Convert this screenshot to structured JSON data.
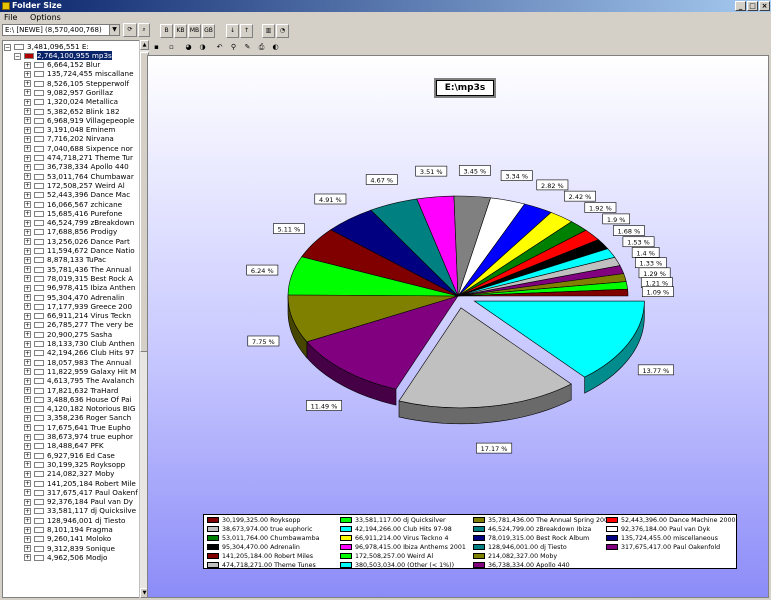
{
  "window": {
    "title": "Folder Size"
  },
  "menu": [
    "File",
    "Options"
  ],
  "drive_select": {
    "value": "E:\\ [NEWE] (8,570,400,768)"
  },
  "toolbar": {
    "b": "B",
    "kb": "KB",
    "mb": "MB",
    "gb": "GB"
  },
  "tree": {
    "root": {
      "size": "3,481,096,551",
      "name": "E:"
    },
    "selected": {
      "size": "2,764,100,955",
      "name": "mp3s"
    },
    "items": [
      {
        "size": "6,664,152",
        "name": "Blur"
      },
      {
        "size": "135,724,455",
        "name": "miscallane"
      },
      {
        "size": "8,526,105",
        "name": "Stepperwolf"
      },
      {
        "size": "9,082,957",
        "name": "Gorillaz"
      },
      {
        "size": "1,320,024",
        "name": "Metallica"
      },
      {
        "size": "5,382,652",
        "name": "Blink 182"
      },
      {
        "size": "6,968,919",
        "name": "Villagepeople"
      },
      {
        "size": "3,191,048",
        "name": "Eminem"
      },
      {
        "size": "7,716,202",
        "name": "Nirvana"
      },
      {
        "size": "7,040,688",
        "name": "Sixpence nor"
      },
      {
        "size": "474,718,271",
        "name": "Theme Tur"
      },
      {
        "size": "36,738,334",
        "name": "Apollo 440"
      },
      {
        "size": "53,011,764",
        "name": "Chumbawar"
      },
      {
        "size": "172,508,257",
        "name": "Weird Al"
      },
      {
        "size": "52,443,396",
        "name": "Dance Mac"
      },
      {
        "size": "16,066,567",
        "name": "zchicane"
      },
      {
        "size": "15,685,416",
        "name": "Purefone"
      },
      {
        "size": "46,524,799",
        "name": "zBreakdown"
      },
      {
        "size": "17,688,856",
        "name": "Prodigy"
      },
      {
        "size": "13,256,026",
        "name": "Dance Part"
      },
      {
        "size": "11,594,672",
        "name": "Dance Natio"
      },
      {
        "size": "8,878,133",
        "name": "TuPac"
      },
      {
        "size": "35,781,436",
        "name": "The Annual"
      },
      {
        "size": "78,019,315",
        "name": "Best Rock A"
      },
      {
        "size": "96,978,415",
        "name": "Ibiza Anthen"
      },
      {
        "size": "95,304,470",
        "name": "Adrenalin"
      },
      {
        "size": "17,177,939",
        "name": "Greece 200"
      },
      {
        "size": "66,911,214",
        "name": "Virus Teckn"
      },
      {
        "size": "26,785,277",
        "name": "The very be"
      },
      {
        "size": "20,900,275",
        "name": "Sasha"
      },
      {
        "size": "18,133,730",
        "name": "Club Anthen"
      },
      {
        "size": "42,194,266",
        "name": "Club Hits 97"
      },
      {
        "size": "18,057,983",
        "name": "The Annual"
      },
      {
        "size": "11,822,959",
        "name": "Galaxy Hit M"
      },
      {
        "size": "4,613,795",
        "name": "The Avalanch"
      },
      {
        "size": "17,821,632",
        "name": "TraHard"
      },
      {
        "size": "3,488,636",
        "name": "House Of Pai"
      },
      {
        "size": "4,120,182",
        "name": "Notorious BIG"
      },
      {
        "size": "3,358,236",
        "name": "Roger Sanch"
      },
      {
        "size": "17,675,641",
        "name": "True Eupho"
      },
      {
        "size": "38,673,974",
        "name": "true euphor"
      },
      {
        "size": "18,488,647",
        "name": "PFK"
      },
      {
        "size": "6,927,916",
        "name": "Ed Case"
      },
      {
        "size": "30,199,325",
        "name": "Royksopp"
      },
      {
        "size": "214,082,327",
        "name": "Moby"
      },
      {
        "size": "141,205,184",
        "name": "Robert Mile"
      },
      {
        "size": "317,675,417",
        "name": "Paul Oakenf"
      },
      {
        "size": "92,376,184",
        "name": "Paul van Dy"
      },
      {
        "size": "33,581,117",
        "name": "dj Quicksilve"
      },
      {
        "size": "128,946,001",
        "name": "dj Tiesto"
      },
      {
        "size": "8,101,194",
        "name": "Fragma"
      },
      {
        "size": "9,260,141",
        "name": "Moloko"
      },
      {
        "size": "9,312,839",
        "name": "Sonique"
      },
      {
        "size": "4,962,506",
        "name": "Modjo"
      }
    ]
  },
  "chart_data": {
    "type": "pie",
    "title": "E:\\mp3s",
    "slices": [
      {
        "pct": 13.77,
        "color": "#00ffff",
        "label": "13.77 %",
        "exploded": true
      },
      {
        "pct": 17.17,
        "color": "#c0c0c0",
        "label": "17.17 %",
        "exploded": true
      },
      {
        "pct": 11.49,
        "color": "#800080",
        "label": "11.49 %"
      },
      {
        "pct": 7.75,
        "color": "#808000",
        "label": "7.75 %"
      },
      {
        "pct": 6.24,
        "color": "#00ff00",
        "label": "6.24 %"
      },
      {
        "pct": 5.11,
        "color": "#800000",
        "label": "5.11 %"
      },
      {
        "pct": 4.91,
        "color": "#000080",
        "label": "4.91 %"
      },
      {
        "pct": 4.67,
        "color": "#008080",
        "label": "4.67 %"
      },
      {
        "pct": 3.51,
        "color": "#ff00ff",
        "label": "3.51 %"
      },
      {
        "pct": 3.45,
        "color": "#808080",
        "label": "3.45 %"
      },
      {
        "pct": 3.34,
        "color": "#ffffff",
        "label": "3.34 %"
      },
      {
        "pct": 2.82,
        "color": "#0000ff",
        "label": "2.82 %"
      },
      {
        "pct": 2.42,
        "color": "#ffff00",
        "label": "2.42 %"
      },
      {
        "pct": 1.92,
        "color": "#008000",
        "label": "1.92 %"
      },
      {
        "pct": 1.9,
        "color": "#ff0000",
        "label": "1.9 %"
      },
      {
        "pct": 1.68,
        "color": "#000000",
        "label": "1.68 %"
      },
      {
        "pct": 1.53,
        "color": "#00ffff",
        "label": "1.53 %"
      },
      {
        "pct": 1.4,
        "color": "#c0c0c0",
        "label": "1.4 %"
      },
      {
        "pct": 1.33,
        "color": "#800080",
        "label": "1.33 %"
      },
      {
        "pct": 1.29,
        "color": "#808000",
        "label": "1.29 %"
      },
      {
        "pct": 1.21,
        "color": "#00ff00",
        "label": "1.21 %"
      },
      {
        "pct": 1.09,
        "color": "#800000",
        "label": "1.09 %"
      }
    ],
    "legend": [
      {
        "color": "#800000",
        "text": "30,199,325.00 Royksopp"
      },
      {
        "color": "#c0c0c0",
        "text": "38,673,974.00 true euphoric"
      },
      {
        "color": "#008000",
        "text": "53,011,764.00 Chumbawamba"
      },
      {
        "color": "#000000",
        "text": "95,304,470.00 Adrenalin"
      },
      {
        "color": "#800000",
        "text": "141,205,184.00 Robert Miles"
      },
      {
        "color": "#c0c0c0",
        "text": "474,718,271.00 Theme Tunes"
      },
      {
        "color": "#00ff00",
        "text": "33,581,117.00 dj Quicksilver"
      },
      {
        "color": "#00ffff",
        "text": "42,194,266.00 Club Hits 97-98"
      },
      {
        "color": "#ffff00",
        "text": "66,911,214.00 Virus Teckno 4"
      },
      {
        "color": "#ff00ff",
        "text": "96,978,415.00 Ibiza Anthems 2001"
      },
      {
        "color": "#00ff00",
        "text": "172,508,257.00 Weird Al"
      },
      {
        "color": "#00ffff",
        "text": "380,503,034.00 (Other (< 1%))"
      },
      {
        "color": "#808000",
        "text": "35,781,436.00 The Annual Spring 2001"
      },
      {
        "color": "#008080",
        "text": "46,524,799.00 zBreakdown Ibiza"
      },
      {
        "color": "#000080",
        "text": "78,019,315.00 Best Rock Album"
      },
      {
        "color": "#008080",
        "text": "128,946,001.00 dj Tiesto"
      },
      {
        "color": "#808000",
        "text": "214,082,327.00 Moby"
      },
      {
        "color": "#800080",
        "text": "36,738,334.00 Apollo 440"
      },
      {
        "color": "#ff0000",
        "text": "52,443,396.00 Dance Machine 2000"
      },
      {
        "color": "#ffffff",
        "text": "92,376,184.00 Paul van Dyk"
      },
      {
        "color": "#000080",
        "text": "135,724,455.00 miscellaneous"
      },
      {
        "color": "#800080",
        "text": "317,675,417.00 Paul Oakenfold"
      }
    ]
  }
}
